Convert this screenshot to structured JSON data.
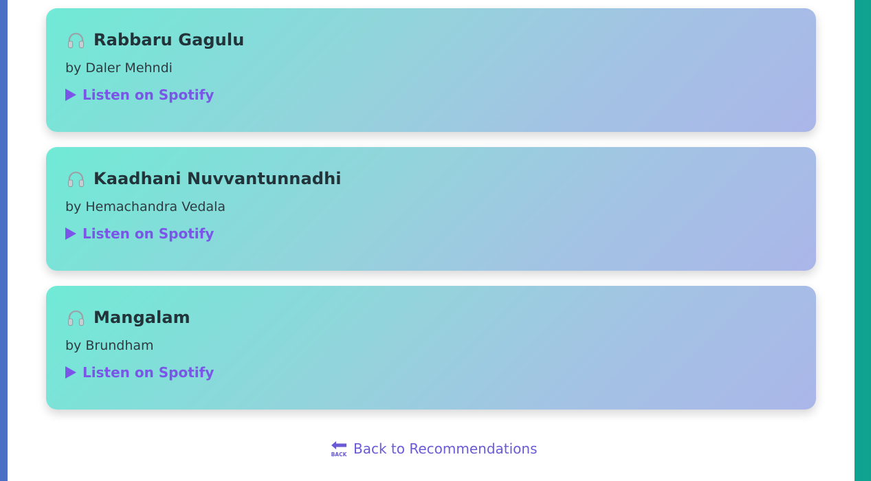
{
  "songs": [
    {
      "title": "Rabbaru Gagulu",
      "artist": "by Daler Mehndi",
      "link_label": "Listen on Spotify",
      "icon": "headphone-icon"
    },
    {
      "title": "Kaadhani Nuvvantunnadhi",
      "artist": "by Hemachandra Vedala",
      "link_label": "Listen on Spotify",
      "icon": "headphone-icon"
    },
    {
      "title": "Mangalam",
      "artist": "by Brundham",
      "link_label": "Listen on Spotify",
      "icon": "headphone-icon"
    }
  ],
  "back_link": {
    "label": "Back to Recommendations",
    "icon": "back-arrow-icon",
    "icon_text": "BACK"
  },
  "colors": {
    "accent": "#7a55e8",
    "title_text": "#22343a",
    "back_link": "#6a5ad6",
    "card_start": "#70ead6",
    "card_end": "#aab6e8"
  }
}
